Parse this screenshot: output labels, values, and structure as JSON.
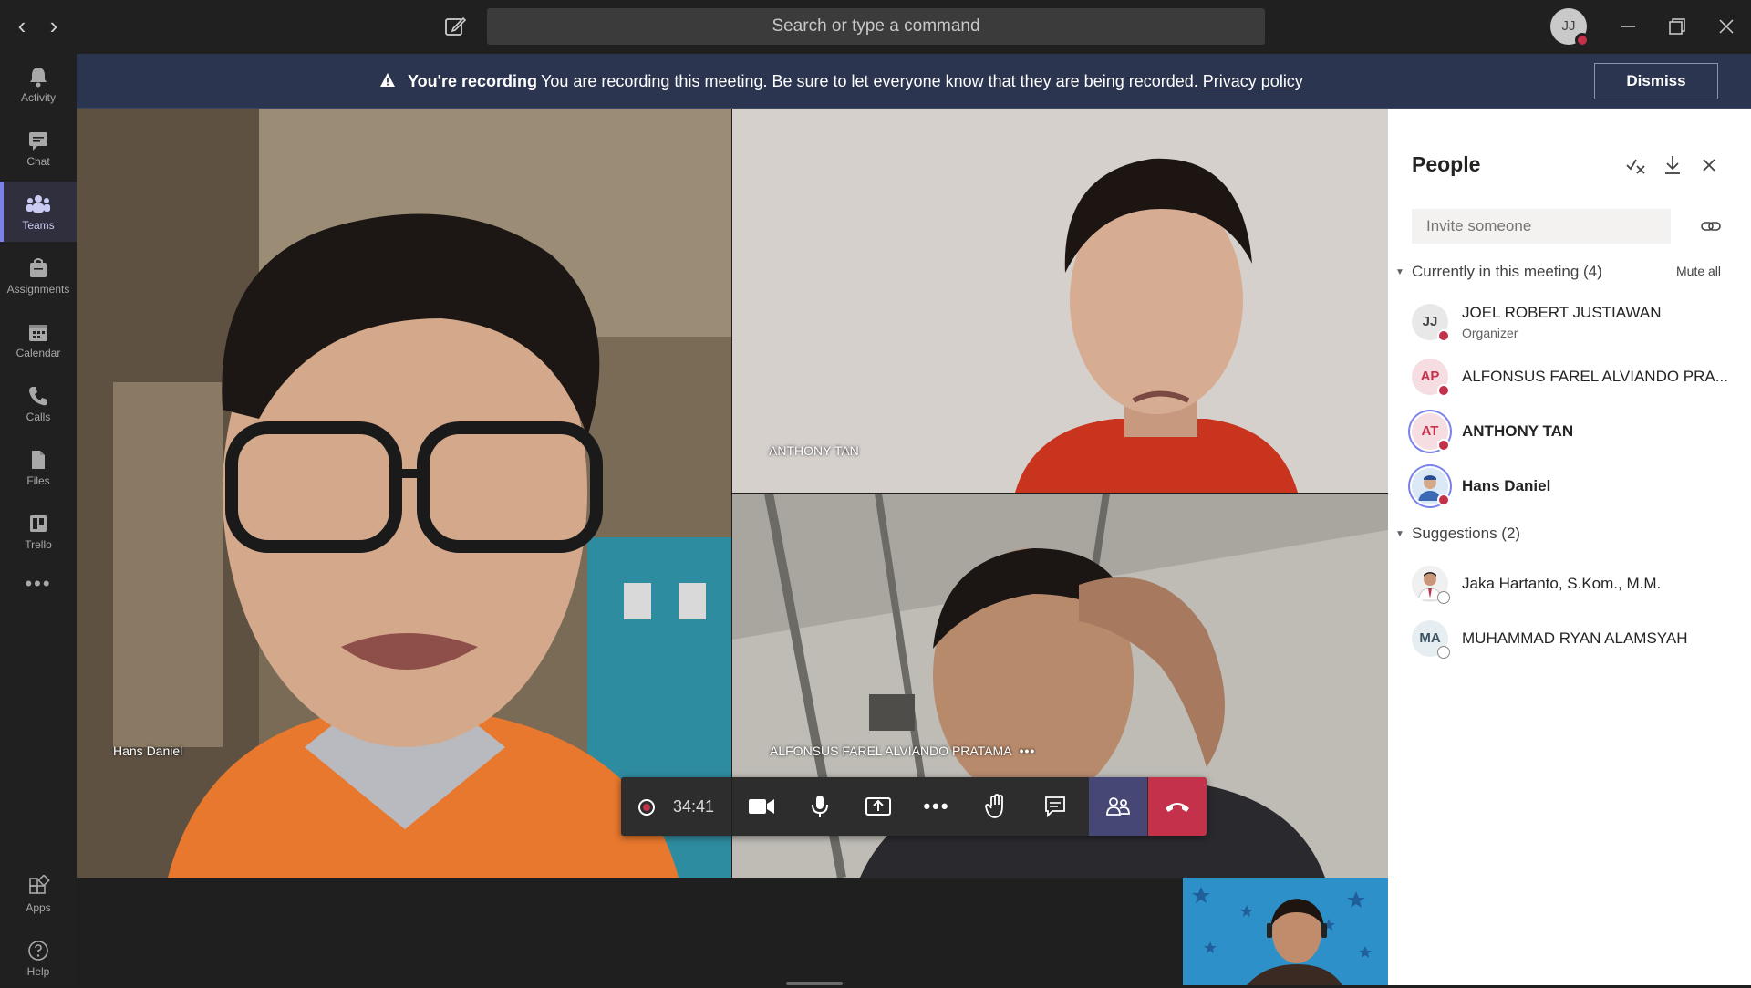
{
  "titlebar": {
    "search_placeholder": "Search or type a command",
    "user_initials": "JJ"
  },
  "rail": {
    "items": [
      {
        "label": "Activity",
        "icon": "bell-icon"
      },
      {
        "label": "Chat",
        "icon": "chat-icon"
      },
      {
        "label": "Teams",
        "icon": "teams-icon"
      },
      {
        "label": "Assignments",
        "icon": "assignments-icon"
      },
      {
        "label": "Calendar",
        "icon": "calendar-icon"
      },
      {
        "label": "Calls",
        "icon": "phone-icon"
      },
      {
        "label": "Files",
        "icon": "files-icon"
      },
      {
        "label": "Trello",
        "icon": "trello-icon"
      }
    ],
    "bottom": [
      {
        "label": "Apps",
        "icon": "apps-icon"
      },
      {
        "label": "Help",
        "icon": "help-icon"
      }
    ]
  },
  "banner": {
    "title": "You're recording",
    "message": "You are recording this meeting. Be sure to let everyone know that they are being recorded.",
    "link": "Privacy policy",
    "dismiss": "Dismiss"
  },
  "stage": {
    "tiles": [
      {
        "name": "Hans Daniel"
      },
      {
        "name": "ANTHONY TAN"
      },
      {
        "name": "ALFONSUS FAREL ALVIANDO PRATAMA",
        "more": "•••"
      }
    ]
  },
  "callbar": {
    "timer": "34:41",
    "more": "•••"
  },
  "panel": {
    "title": "People",
    "invite_placeholder": "Invite someone",
    "meeting_section": "Currently in this meeting (4)",
    "mute_all": "Mute all",
    "participants": [
      {
        "initials": "JJ",
        "name": "JOEL ROBERT JUSTIAWAN",
        "role": "Organizer"
      },
      {
        "initials": "AP",
        "name": "ALFONSUS FAREL ALVIANDO PRA..."
      },
      {
        "initials": "AT",
        "name": "ANTHONY TAN"
      },
      {
        "initials": "",
        "name": "Hans Daniel"
      }
    ],
    "suggestions_section": "Suggestions (2)",
    "suggestions": [
      {
        "initials": "",
        "name": "Jaka Hartanto, S.Kom., M.M."
      },
      {
        "initials": "MA",
        "name": "MUHAMMAD RYAN ALAMSYAH"
      }
    ]
  },
  "colors": {
    "accent": "#7b83eb",
    "banner": "#2b3550",
    "hangup": "#c4314b",
    "presence_busy": "#c4314b"
  }
}
